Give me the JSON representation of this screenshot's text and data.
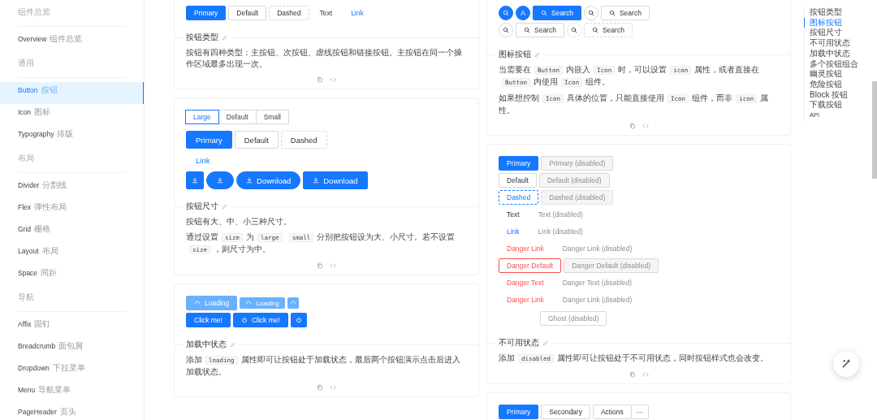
{
  "sidebar": {
    "groups": [
      {
        "title": "组件总览",
        "items": [
          {
            "label": "Overview",
            "subtitle": "组件总览",
            "selected": false
          }
        ]
      },
      {
        "title": "通用",
        "items": [
          {
            "label": "Button",
            "subtitle": "按钮",
            "selected": true
          },
          {
            "label": "Icon",
            "subtitle": "图标",
            "selected": false
          },
          {
            "label": "Typography",
            "subtitle": "排版",
            "selected": false
          }
        ]
      },
      {
        "title": "布局",
        "items": [
          {
            "label": "Divider",
            "subtitle": "分割线",
            "selected": false
          },
          {
            "label": "Flex",
            "subtitle": "弹性布局",
            "selected": false
          },
          {
            "label": "Grid",
            "subtitle": "栅格",
            "selected": false
          },
          {
            "label": "Layout",
            "subtitle": "布局",
            "selected": false
          },
          {
            "label": "Space",
            "subtitle": "间距",
            "selected": false
          }
        ]
      },
      {
        "title": "导航",
        "items": [
          {
            "label": "Affix",
            "subtitle": "固钉",
            "selected": false
          },
          {
            "label": "Breadcrumb",
            "subtitle": "面包屑",
            "selected": false
          },
          {
            "label": "Dropdown",
            "subtitle": "下拉菜单",
            "selected": false
          },
          {
            "label": "Menu",
            "subtitle": "导航菜单",
            "selected": false
          },
          {
            "label": "PageHeader",
            "subtitle": "页头",
            "selected": false
          }
        ]
      }
    ]
  },
  "columns": [
    {
      "cards": [
        {
          "demo": [
            {
              "kind": "buttons",
              "buttons": [
                {
                  "kind": "primary",
                  "label": "Primary"
                },
                {
                  "kind": "default",
                  "label": "Default"
                },
                {
                  "kind": "dashed",
                  "label": "Dashed"
                },
                {
                  "kind": "text",
                  "label": "Text"
                },
                {
                  "kind": "link",
                  "label": "Link"
                }
              ]
            }
          ],
          "title": "按钮类型",
          "paragraphs": [
            [
              {
                "kind": "text",
                "text": "按钮有四种类型：主按钮、次按钮、虚线按钮和链接按钮。主按钮在同一个操作区域最多出现一次。"
              }
            ]
          ]
        },
        {
          "demo": [
            {
              "kind": "radio-group",
              "options": [
                {
                  "label": "Large",
                  "selected": true
                },
                {
                  "label": "Default",
                  "selected": false
                },
                {
                  "label": "Small",
                  "selected": false
                }
              ]
            },
            {
              "kind": "buttons",
              "buttons": [
                {
                  "kind": "primary",
                  "label": "Primary"
                },
                {
                  "kind": "default",
                  "label": "Default"
                },
                {
                  "kind": "dashed",
                  "label": "Dashed"
                }
              ]
            },
            {
              "kind": "buttons",
              "buttons": [
                {
                  "kind": "link",
                  "label": "Link"
                }
              ]
            },
            {
              "kind": "buttons",
              "buttons": [
                {
                  "kind": "primary"
                },
                {
                  "kind": "primary"
                },
                {
                  "kind": "primary",
                  "label": "Download"
                },
                {
                  "kind": "primary",
                  "label": "Download"
                }
              ]
            }
          ],
          "title": "按钮尺寸",
          "paragraphs": [
            [
              {
                "kind": "text",
                "text": "按钮有大、中、小三种尺寸。"
              }
            ],
            [
              {
                "kind": "text",
                "text": "通过设置"
              },
              {
                "kind": "code",
                "text": "size"
              },
              {
                "kind": "text",
                "text": "为"
              },
              {
                "kind": "code",
                "text": "large"
              },
              {
                "kind": "code",
                "text": "small"
              },
              {
                "kind": "text",
                "text": "分别把按钮设为大、小尺寸。若不设置"
              },
              {
                "kind": "code",
                "text": "size"
              },
              {
                "kind": "text",
                "text": "，则尺寸为中。"
              }
            ]
          ]
        },
        {
          "demo": [
            {
              "kind": "buttons",
              "buttons": [
                {
                  "kind": "primary",
                  "label": "Loading",
                  "loading": true
                },
                {
                  "kind": "primary",
                  "label": "Loading",
                  "loading": true
                },
                {
                  "kind": "primary",
                  "loading": true
                }
              ]
            },
            {
              "kind": "buttons",
              "buttons": [
                {
                  "kind": "primary",
                  "label": "Click me!",
                  "loading": false
                },
                {
                  "kind": "primary",
                  "label": "Click me!",
                  "loading": false
                },
                {
                  "kind": "primary",
                  "loading": false
                }
              ]
            }
          ],
          "title": "加载中状态",
          "paragraphs": [
            [
              {
                "kind": "text",
                "text": "添加"
              },
              {
                "kind": "code",
                "text": "loading"
              },
              {
                "kind": "text",
                "text": "属性即可让按钮处于加载状态，最后两个按钮演示点击后进入加载状态。"
              }
            ]
          ]
        }
      ]
    },
    {
      "cards": [
        {
          "demo": [
            {
              "kind": "buttons",
              "buttons": [
                {
                  "kind": "primary"
                },
                {
                  "kind": "primary",
                  "label": "A"
                },
                {
                  "kind": "primary",
                  "label": "Search"
                },
                {
                  "kind": "default"
                },
                {
                  "kind": "default",
                  "label": "Search"
                }
              ]
            },
            {
              "kind": "buttons",
              "buttons": [
                {
                  "kind": "default"
                },
                {
                  "kind": "default",
                  "label": "Search"
                },
                {
                  "kind": "dashed"
                },
                {
                  "kind": "dashed",
                  "label": "Search"
                }
              ]
            }
          ],
          "title": "图标按钮",
          "paragraphs": [
            [
              {
                "kind": "text",
                "text": "当需要在"
              },
              {
                "kind": "code",
                "text": "Button"
              },
              {
                "kind": "text",
                "text": "内嵌入"
              },
              {
                "kind": "code",
                "text": "Icon"
              },
              {
                "kind": "text",
                "text": "时，可以设置"
              },
              {
                "kind": "code",
                "text": "icon"
              },
              {
                "kind": "text",
                "text": "属性，或者直接在"
              },
              {
                "kind": "code",
                "text": "Button"
              },
              {
                "kind": "text",
                "text": "内使用"
              },
              {
                "kind": "code",
                "text": "Icon"
              },
              {
                "kind": "text",
                "text": "组件。"
              }
            ],
            [
              {
                "kind": "text",
                "text": "如果想控制"
              },
              {
                "kind": "code",
                "text": "Icon"
              },
              {
                "kind": "text",
                "text": "具体的位置，只能直接使用"
              },
              {
                "kind": "code",
                "text": "Icon"
              },
              {
                "kind": "text",
                "text": "组件，而非"
              },
              {
                "kind": "code",
                "text": "icon"
              },
              {
                "kind": "text",
                "text": "属性。"
              }
            ]
          ]
        },
        {
          "demo": [
            {
              "kind": "buttons",
              "buttons": [
                {
                  "kind": "primary",
                  "label": "Primary",
                  "disabled": false
                },
                {
                  "kind": "primary",
                  "label": "Primary (disabled)",
                  "disabled": true
                }
              ]
            },
            {
              "kind": "buttons",
              "buttons": [
                {
                  "kind": "default",
                  "label": "Default",
                  "disabled": false
                },
                {
                  "kind": "default",
                  "label": "Default (disabled)",
                  "disabled": true
                }
              ]
            },
            {
              "kind": "buttons",
              "buttons": [
                {
                  "kind": "dashed",
                  "label": "Dashed",
                  "disabled": false,
                  "focused": true
                },
                {
                  "kind": "dashed",
                  "label": "Dashed (disabled)",
                  "disabled": true,
                  "focused": false
                }
              ]
            },
            {
              "kind": "buttons",
              "buttons": [
                {
                  "kind": "text",
                  "label": "Text",
                  "disabled": false
                },
                {
                  "kind": "text",
                  "label": "Text (disabled)",
                  "disabled": true
                }
              ]
            },
            {
              "kind": "buttons",
              "buttons": [
                {
                  "kind": "link",
                  "label": "Link",
                  "disabled": false
                },
                {
                  "kind": "link",
                  "label": "Link (disabled)",
                  "disabled": true
                }
              ]
            },
            {
              "kind": "buttons",
              "buttons": [
                {
                  "kind": "danger-link",
                  "label": "Danger Link",
                  "disabled": false
                },
                {
                  "kind": "danger-link",
                  "label": "Danger Link (disabled)",
                  "disabled": true
                }
              ]
            },
            {
              "kind": "buttons",
              "buttons": [
                {
                  "kind": "danger-default",
                  "label": "Danger Default",
                  "disabled": false
                },
                {
                  "kind": "danger-default",
                  "label": "Danger Default (disabled)",
                  "disabled": true
                }
              ]
            },
            {
              "kind": "buttons",
              "buttons": [
                {
                  "kind": "danger-text",
                  "label": "Danger Text",
                  "disabled": false
                },
                {
                  "kind": "danger-text",
                  "label": "Danger Text (disabled)",
                  "disabled": true
                }
              ]
            },
            {
              "kind": "buttons",
              "buttons": [
                {
                  "kind": "danger-link",
                  "label": "Danger Link",
                  "disabled": false
                },
                {
                  "kind": "danger-link",
                  "label": "Danger Link (disabled)",
                  "disabled": true
                }
              ]
            },
            {
              "kind": "ghost-buttons",
              "buttons": [
                {
                  "kind": "ghost",
                  "label": "Ghost (disabled)",
                  "disabled": true
                }
              ]
            }
          ],
          "title": "不可用状态",
          "paragraphs": [
            [
              {
                "kind": "text",
                "text": "添加"
              },
              {
                "kind": "code",
                "text": "disabled"
              },
              {
                "kind": "text",
                "text": "属性即可让按钮处于不可用状态，同时按钮样式也会改变。"
              }
            ]
          ]
        },
        {
          "demo": [
            {
              "kind": "buttons",
              "buttons": [
                {
                  "kind": "primary",
                  "label": "Primary"
                },
                {
                  "kind": "default",
                  "label": "Secondary"
                },
                {
                  "kind": "split",
                  "label": "Actions",
                  "menu": "···"
                }
              ]
            }
          ]
        }
      ]
    }
  ],
  "toc": [
    {
      "label": "按钮类型",
      "selected": false
    },
    {
      "label": "图标按钮",
      "selected": true
    },
    {
      "label": "按钮尺寸",
      "selected": false
    },
    {
      "label": "不可用状态",
      "selected": false
    },
    {
      "label": "加载中状态",
      "selected": false
    },
    {
      "label": "多个按钮组合",
      "selected": false
    },
    {
      "label": "幽灵按钮",
      "selected": false
    },
    {
      "label": "危险按钮",
      "selected": false
    },
    {
      "label": "Block 按钮",
      "selected": false
    },
    {
      "label": "下载按钮",
      "selected": false
    },
    {
      "label": "API",
      "selected": false
    }
  ]
}
